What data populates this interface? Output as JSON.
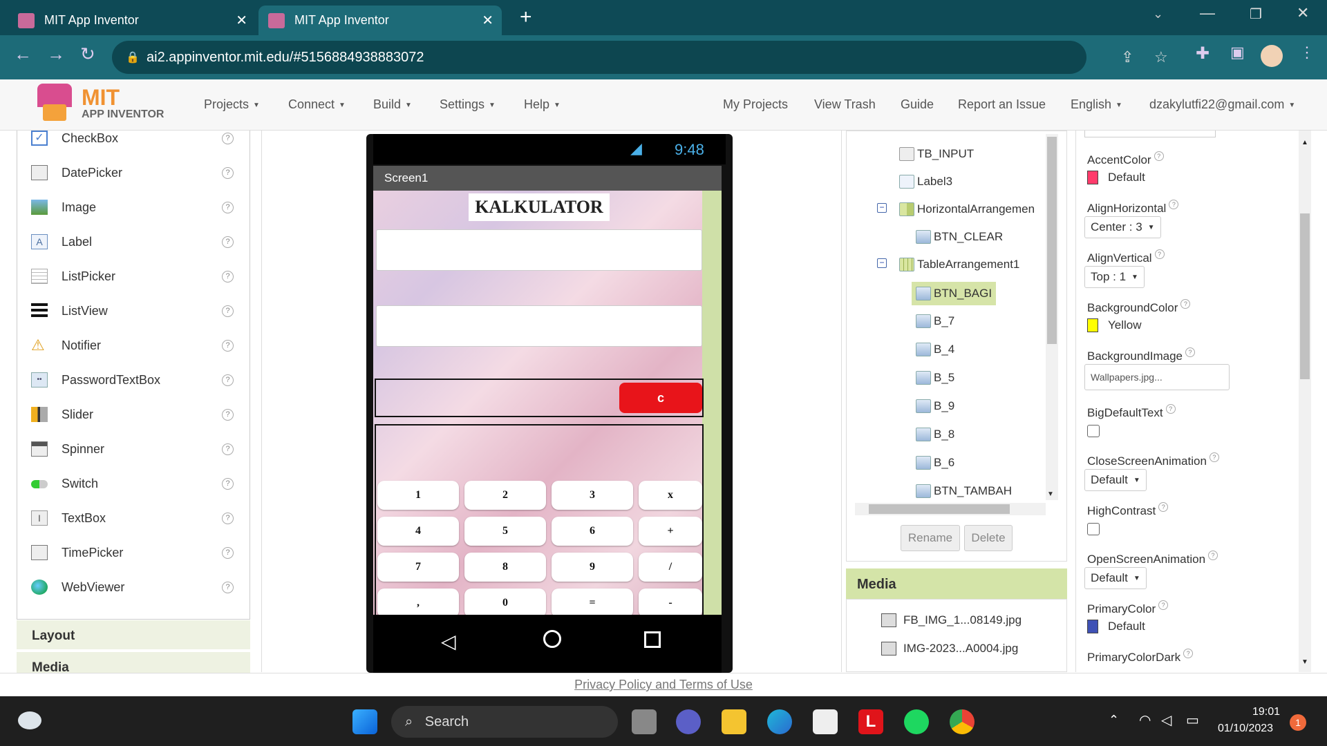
{
  "browser": {
    "tabs": [
      {
        "title": "MIT App Inventor",
        "close": "✕"
      },
      {
        "title": "MIT App Inventor",
        "close": "✕"
      }
    ],
    "new_tab": "+",
    "url": "ai2.appinventor.mit.edu/#5156884938883072"
  },
  "header": {
    "logo_top": "MIT",
    "logo_bottom": "APP INVENTOR",
    "menus": [
      "Projects",
      "Connect",
      "Build",
      "Settings",
      "Help"
    ],
    "links": [
      "My Projects",
      "View Trash",
      "Guide",
      "Report an Issue"
    ],
    "language": "English",
    "account": "dzakylutfi22@gmail.com"
  },
  "palette": {
    "items": [
      "CheckBox",
      "DatePicker",
      "Image",
      "Label",
      "ListPicker",
      "ListView",
      "Notifier",
      "PasswordTextBox",
      "Slider",
      "Spinner",
      "Switch",
      "TextBox",
      "TimePicker",
      "WebViewer"
    ],
    "help": "?",
    "sections": [
      "Layout",
      "Media"
    ]
  },
  "phone": {
    "time": "9:48",
    "screen_title": "Screen1",
    "app_title": "KALKULATOR",
    "clear_button": "c",
    "keys": [
      [
        "1",
        "2",
        "3",
        "x"
      ],
      [
        "4",
        "5",
        "6",
        "+"
      ],
      [
        "7",
        "8",
        "9",
        "/"
      ],
      [
        ",",
        "0",
        "=",
        "-"
      ]
    ]
  },
  "components": {
    "items": [
      "TB_INPUT",
      "Label3",
      "HorizontalArrangemen",
      "BTN_CLEAR",
      "TableArrangement1",
      "BTN_BAGI",
      "B_7",
      "B_4",
      "B_5",
      "B_9",
      "B_8",
      "B_6",
      "BTN_TAMBAH"
    ],
    "selected": "BTN_BAGI",
    "collapse": "−",
    "rename": "Rename",
    "delete": "Delete"
  },
  "media": {
    "title": "Media",
    "files": [
      "FB_IMG_1...08149.jpg",
      "IMG-2023...A0004.jpg"
    ]
  },
  "properties": {
    "AccentColor": {
      "label": "AccentColor",
      "value": "Default",
      "color": "#ff3b6b"
    },
    "AlignHorizontal": {
      "label": "AlignHorizontal",
      "value": "Center : 3"
    },
    "AlignVertical": {
      "label": "AlignVertical",
      "value": "Top : 1"
    },
    "BackgroundColor": {
      "label": "BackgroundColor",
      "value": "Yellow",
      "color": "#ffff00"
    },
    "BackgroundImage": {
      "label": "BackgroundImage",
      "value": "Wallpapers.jpg..."
    },
    "BigDefaultText": {
      "label": "BigDefaultText"
    },
    "CloseScreenAnimation": {
      "label": "CloseScreenAnimation",
      "value": "Default"
    },
    "HighContrast": {
      "label": "HighContrast"
    },
    "OpenScreenAnimation": {
      "label": "OpenScreenAnimation",
      "value": "Default"
    },
    "PrimaryColor": {
      "label": "PrimaryColor",
      "value": "Default",
      "color": "#3f51b5"
    },
    "PrimaryColorDark": {
      "label": "PrimaryColorDark"
    },
    "help": "?"
  },
  "footer": {
    "privacy": "Privacy Policy and Terms of Use"
  },
  "taskbar": {
    "search": "Search",
    "time": "19:01",
    "date": "01/10/2023",
    "notifications": "1"
  }
}
